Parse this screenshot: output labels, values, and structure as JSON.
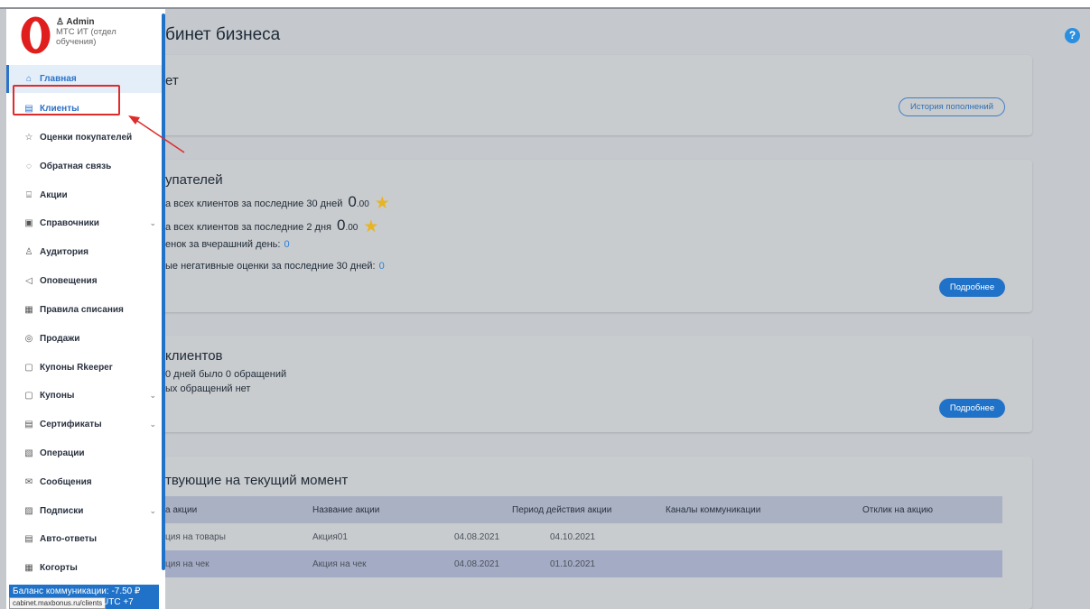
{
  "page": {
    "title": "бинет бизнеса",
    "help_label": "?"
  },
  "sidebar": {
    "user_name": "Admin",
    "user_org_line1": "МТС ИТ (отдел",
    "user_org_line2": "обучения)",
    "items": [
      {
        "label": "Главная",
        "icon": "home-icon",
        "glyph": "⌂"
      },
      {
        "label": "Клиенты",
        "icon": "clients-icon",
        "glyph": "▤"
      },
      {
        "label": "Оценки покупателей",
        "icon": "star-icon",
        "glyph": "☆"
      },
      {
        "label": "Обратная связь",
        "icon": "chat-icon",
        "glyph": "◌"
      },
      {
        "label": "Акции",
        "icon": "gift-icon",
        "glyph": "⌸"
      },
      {
        "label": "Справочники",
        "icon": "book-icon",
        "glyph": "▣"
      },
      {
        "label": "Аудитория",
        "icon": "audience-icon",
        "glyph": "♙"
      },
      {
        "label": "Оповещения",
        "icon": "notify-icon",
        "glyph": "◁"
      },
      {
        "label": "Правила списания",
        "icon": "rules-icon",
        "glyph": "▦"
      },
      {
        "label": "Продажи",
        "icon": "sales-icon",
        "glyph": "◎"
      },
      {
        "label": "Купоны Rkeeper",
        "icon": "coupon-rkeeper-icon",
        "glyph": "▢"
      },
      {
        "label": "Купоны",
        "icon": "coupon-icon",
        "glyph": "▢"
      },
      {
        "label": "Сертификаты",
        "icon": "certificate-icon",
        "glyph": "▤"
      },
      {
        "label": "Операции",
        "icon": "operations-icon",
        "glyph": "▧"
      },
      {
        "label": "Сообщения",
        "icon": "mail-icon",
        "glyph": "✉"
      },
      {
        "label": "Подписки",
        "icon": "subscription-icon",
        "glyph": "▨"
      },
      {
        "label": "Авто-ответы",
        "icon": "autoreply-icon",
        "glyph": "▤"
      },
      {
        "label": "Когорты",
        "icon": "cohort-icon",
        "glyph": "▦"
      }
    ],
    "chevron": "⌄",
    "balance": "Баланс коммуникации: -7.50 ₽",
    "url": "cabinet.maxbonus.ru/clients",
    "timezone": "UTC +7"
  },
  "card1": {
    "title": "ет",
    "history_button": "История пополнений"
  },
  "card2": {
    "title": "упателей",
    "line1": "а всех клиентов за последние 30 дней",
    "line1_value_int": "0",
    "line1_value_dec": ".00",
    "line2": "а всех клиентов за последние 2 дня",
    "line2_value_int": "0",
    "line2_value_dec": ".00",
    "line3": "енок за вчерашний день:",
    "line3_value": "0",
    "line4": "ые негативные оценки за последние 30 дней:",
    "line4_value": "0",
    "more_button": "Подробнее"
  },
  "card3": {
    "title": "клиентов",
    "line1": "0 дней было 0 обращений",
    "line2": "ых обращений нет",
    "more_button": "Подробнее"
  },
  "card4": {
    "title": "твующие на текущий момент",
    "columns": [
      "а акции",
      "Название акции",
      "Период действия акции",
      "Каналы коммуникации",
      "Отклик на акцию"
    ],
    "rows": [
      {
        "type": "ция на товары",
        "name": "Акция01",
        "start": "04.08.2021",
        "end": "04.10.2021"
      },
      {
        "type": "ция на чек",
        "name": "Акция на чек",
        "start": "04.08.2021",
        "end": "01.10.2021"
      }
    ]
  },
  "colors": {
    "accent": "#1f72c8",
    "highlight_box": "#e02b2b",
    "star": "#e8b422"
  }
}
